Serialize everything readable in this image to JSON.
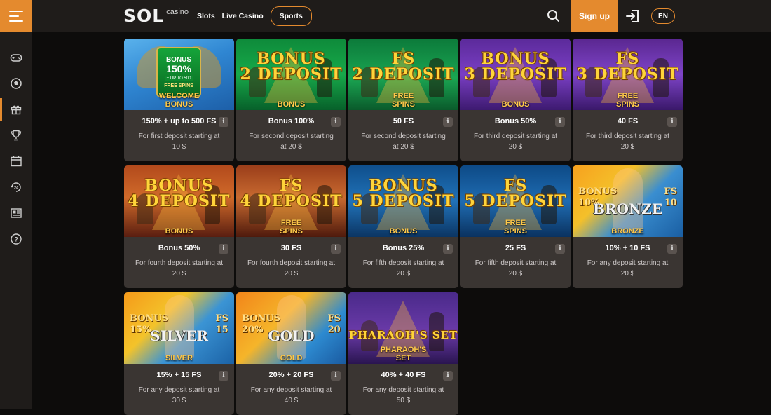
{
  "header": {
    "logo_main": "SOL",
    "logo_sub": "casino",
    "nav": [
      {
        "label": "Slots"
      },
      {
        "label": "Live Casino"
      },
      {
        "label": "Sports"
      }
    ],
    "signup_label": "Sign up",
    "lang_label": "EN"
  },
  "sidebar": {
    "items": [
      {
        "icon": "gamepad-icon"
      },
      {
        "icon": "soccer-ball-icon"
      },
      {
        "icon": "gift-icon",
        "active": true
      },
      {
        "icon": "trophy-icon"
      },
      {
        "icon": "calendar-icon"
      },
      {
        "icon": "support-24-icon"
      },
      {
        "icon": "news-icon"
      },
      {
        "icon": "help-icon"
      }
    ]
  },
  "promos": [
    {
      "img_text": "",
      "img_tag": "WELCOME\nBONUS",
      "title": "150% + up to 500 FS",
      "desc": "For first deposit starting at 10 $",
      "bg": "linear-gradient(160deg,#5ab2ec 0%,#2f86d2 45%,#1d5fa8 100%)",
      "badge": {
        "w1": "BONUS",
        "w2": "150%",
        "w3": "+ UP TO 500",
        "w4": "FREE SPINS"
      }
    },
    {
      "img_text": "BONUS\n2 DEPOSIT",
      "img_tag": "BONUS",
      "title": "Bonus 100%",
      "desc": "For second deposit starting at 20 $",
      "bg": "linear-gradient(180deg,#0e8a3a 0%,#17a94a 50%,#07602a 100%)"
    },
    {
      "img_text": "FS\n2 DEPOSIT",
      "img_tag": "FREE\nSPINS",
      "title": "50 FS",
      "desc": "For second deposit starting at 20 $",
      "bg": "linear-gradient(180deg,#0c7a3a 0%,#1aa552 55%,#0a5a2b 100%)"
    },
    {
      "img_text": "BONUS\n3 DEPOSIT",
      "img_tag": "BONUS",
      "title": "Bonus 50%",
      "desc": "For third deposit starting at 20 $",
      "bg": "linear-gradient(180deg,#5b2a9a 0%,#7a3fc4 50%,#3d1a70 100%)"
    },
    {
      "img_text": "FS\n3 DEPOSIT",
      "img_tag": "FREE\nSPINS",
      "title": "40 FS",
      "desc": "For third deposit starting at 20 $",
      "bg": "linear-gradient(180deg,#5a2790 0%,#7e44c8 50%,#3a186a 100%)"
    },
    {
      "img_text": "BONUS\n4 DEPOSIT",
      "img_tag": "BONUS",
      "title": "Bonus 50%",
      "desc": "For fourth deposit starting at 20 $",
      "bg": "linear-gradient(180deg,#b24a1c 0%,#d06a2a 45%,#5a1e10 100%)"
    },
    {
      "img_text": "FS\n4 DEPOSIT",
      "img_tag": "FREE\nSPINS",
      "title": "30 FS",
      "desc": "For fourth deposit starting at 20 $",
      "bg": "linear-gradient(180deg,#9a3e1a 0%,#c86a30 45%,#4f1a0c 100%)"
    },
    {
      "img_text": "BONUS\n5 DEPOSIT",
      "img_tag": "BONUS",
      "title": "Bonus 25%",
      "desc": "For fifth deposit starting at 20 $",
      "bg": "linear-gradient(180deg,#0f4f8c 0%,#2172b8 50%,#0b3563 100%)"
    },
    {
      "img_text": "FS\n5 DEPOSIT",
      "img_tag": "FREE\nSPINS",
      "title": "25 FS",
      "desc": "For fifth deposit starting at 20 $",
      "bg": "linear-gradient(180deg,#0d4a86 0%,#1f6cb2 50%,#0a3260 100%)"
    },
    {
      "img_text": "",
      "img_tag": "BRONZE",
      "title": "10% + 10 FS",
      "desc": "For any deposit starting at 20 $",
      "bg": "linear-gradient(135deg,#f7a11e 0%,#f4c02a 35%,#3a8ed0 60%,#1a5fa3 100%)",
      "tier": {
        "left": "BONUS\n10%",
        "right": "FS\n10",
        "word": "BRONZE"
      }
    },
    {
      "img_text": "",
      "img_tag": "SILVER",
      "title": "15% + 15 FS",
      "desc": "For any deposit starting at 30 $",
      "bg": "linear-gradient(135deg,#f59a1a 0%,#f3c32a 35%,#3b94d4 60%,#1b62a6 100%)",
      "tier": {
        "left": "BONUS\n15%",
        "right": "FS\n15",
        "word": "SILVER"
      }
    },
    {
      "img_text": "",
      "img_tag": "GOLD",
      "title": "20% + 20 FS",
      "desc": "For any deposit starting at 40 $",
      "bg": "linear-gradient(135deg,#f2851a 0%,#f5b52a 40%,#2d8ad0 70%,#1a5aa0 100%)",
      "tier": {
        "left": "BONUS\n20%",
        "right": "FS\n20",
        "word": "GOLD"
      }
    },
    {
      "img_text": "PHARAOH'S SET",
      "img_tag": "PHARAOH'S\nSET",
      "title": "40% + 40 FS",
      "desc": "For any deposit starting at 50 $",
      "bg": "linear-gradient(180deg,#4a2a8a 0%,#6a3aa8 55%,#2a1550 100%)"
    }
  ],
  "colors": {
    "accent": "#e48a2e",
    "card_bg": "#3a3532",
    "page_bg": "#0d0c0b",
    "header_bg": "#1f1c1a"
  }
}
